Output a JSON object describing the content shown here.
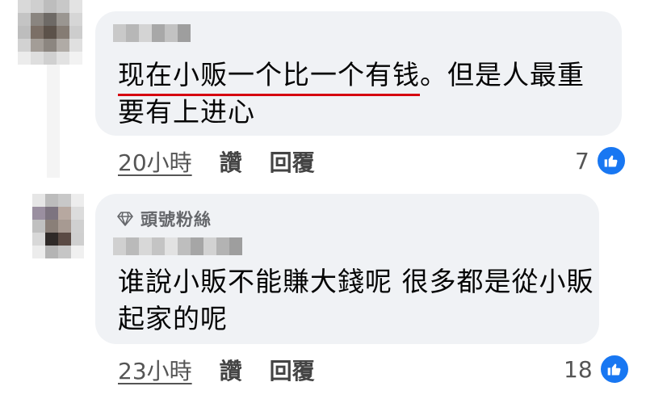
{
  "comments": [
    {
      "text_underlined": "现在小贩一个比一个有钱",
      "text_rest": "。但是人最重要有上进心",
      "time": "20小時",
      "like_action": "讚",
      "reply_action": "回覆",
      "like_count": "7"
    },
    {
      "badge": "頭號粉絲",
      "text": "谁說小販不能賺大錢呢 很多都是從小販起家的呢",
      "time": "23小時",
      "like_action": "讚",
      "reply_action": "回覆",
      "like_count": "18"
    }
  ],
  "colors": {
    "bubble": "#f0f2f5",
    "like_blue": "#1877f2",
    "underline_red": "#d5000f"
  },
  "icons": [
    "diamond-icon",
    "thumbs-up-icon"
  ]
}
